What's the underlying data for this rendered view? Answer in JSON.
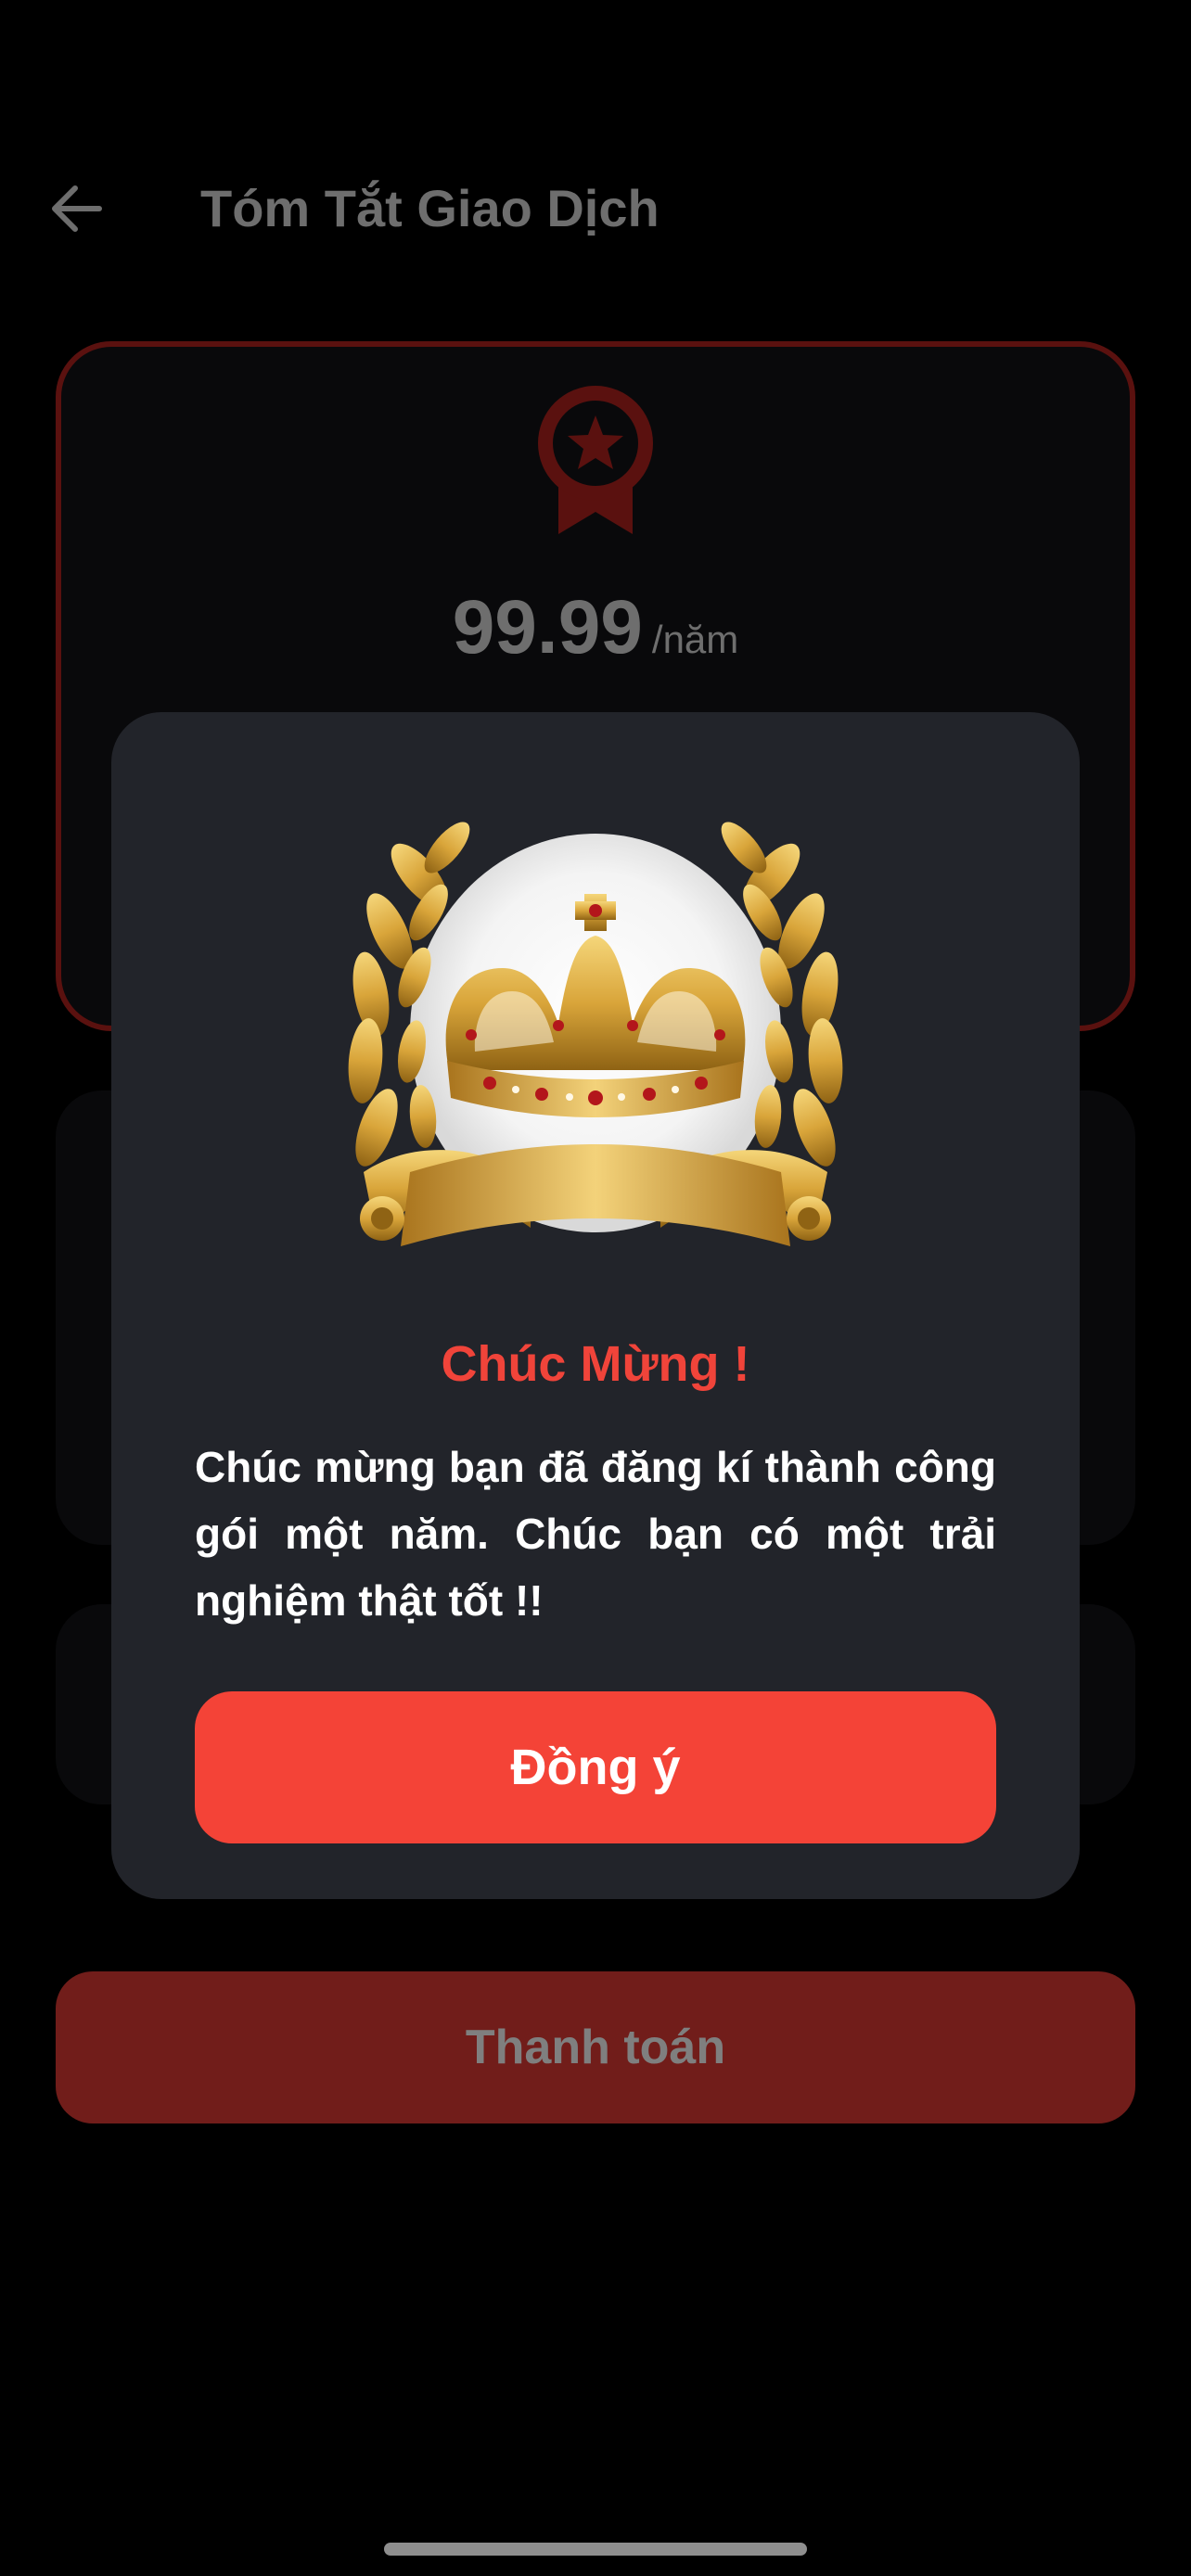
{
  "header": {
    "title": "Tóm Tắt Giao Dịch",
    "back_icon": "arrow-left-icon"
  },
  "plan": {
    "icon": "award-medal-icon",
    "price": "99.99",
    "period": "/năm"
  },
  "pay_button": {
    "label": "Thanh toán"
  },
  "dialog": {
    "emblem": "golden-crown-laurel-emblem",
    "title": "Chúc Mừng !",
    "message": "Chúc mừng bạn đã đăng kí thành công gói một năm. Chúc bạn có một trải nghiệm thật tốt !!",
    "confirm_label": "Đồng ý"
  },
  "colors": {
    "background": "#000000",
    "card": "#121316",
    "card_border": "#b4231e",
    "dialog": "#22242a",
    "accent": "#f44337",
    "title_accent": "#f0443a"
  }
}
